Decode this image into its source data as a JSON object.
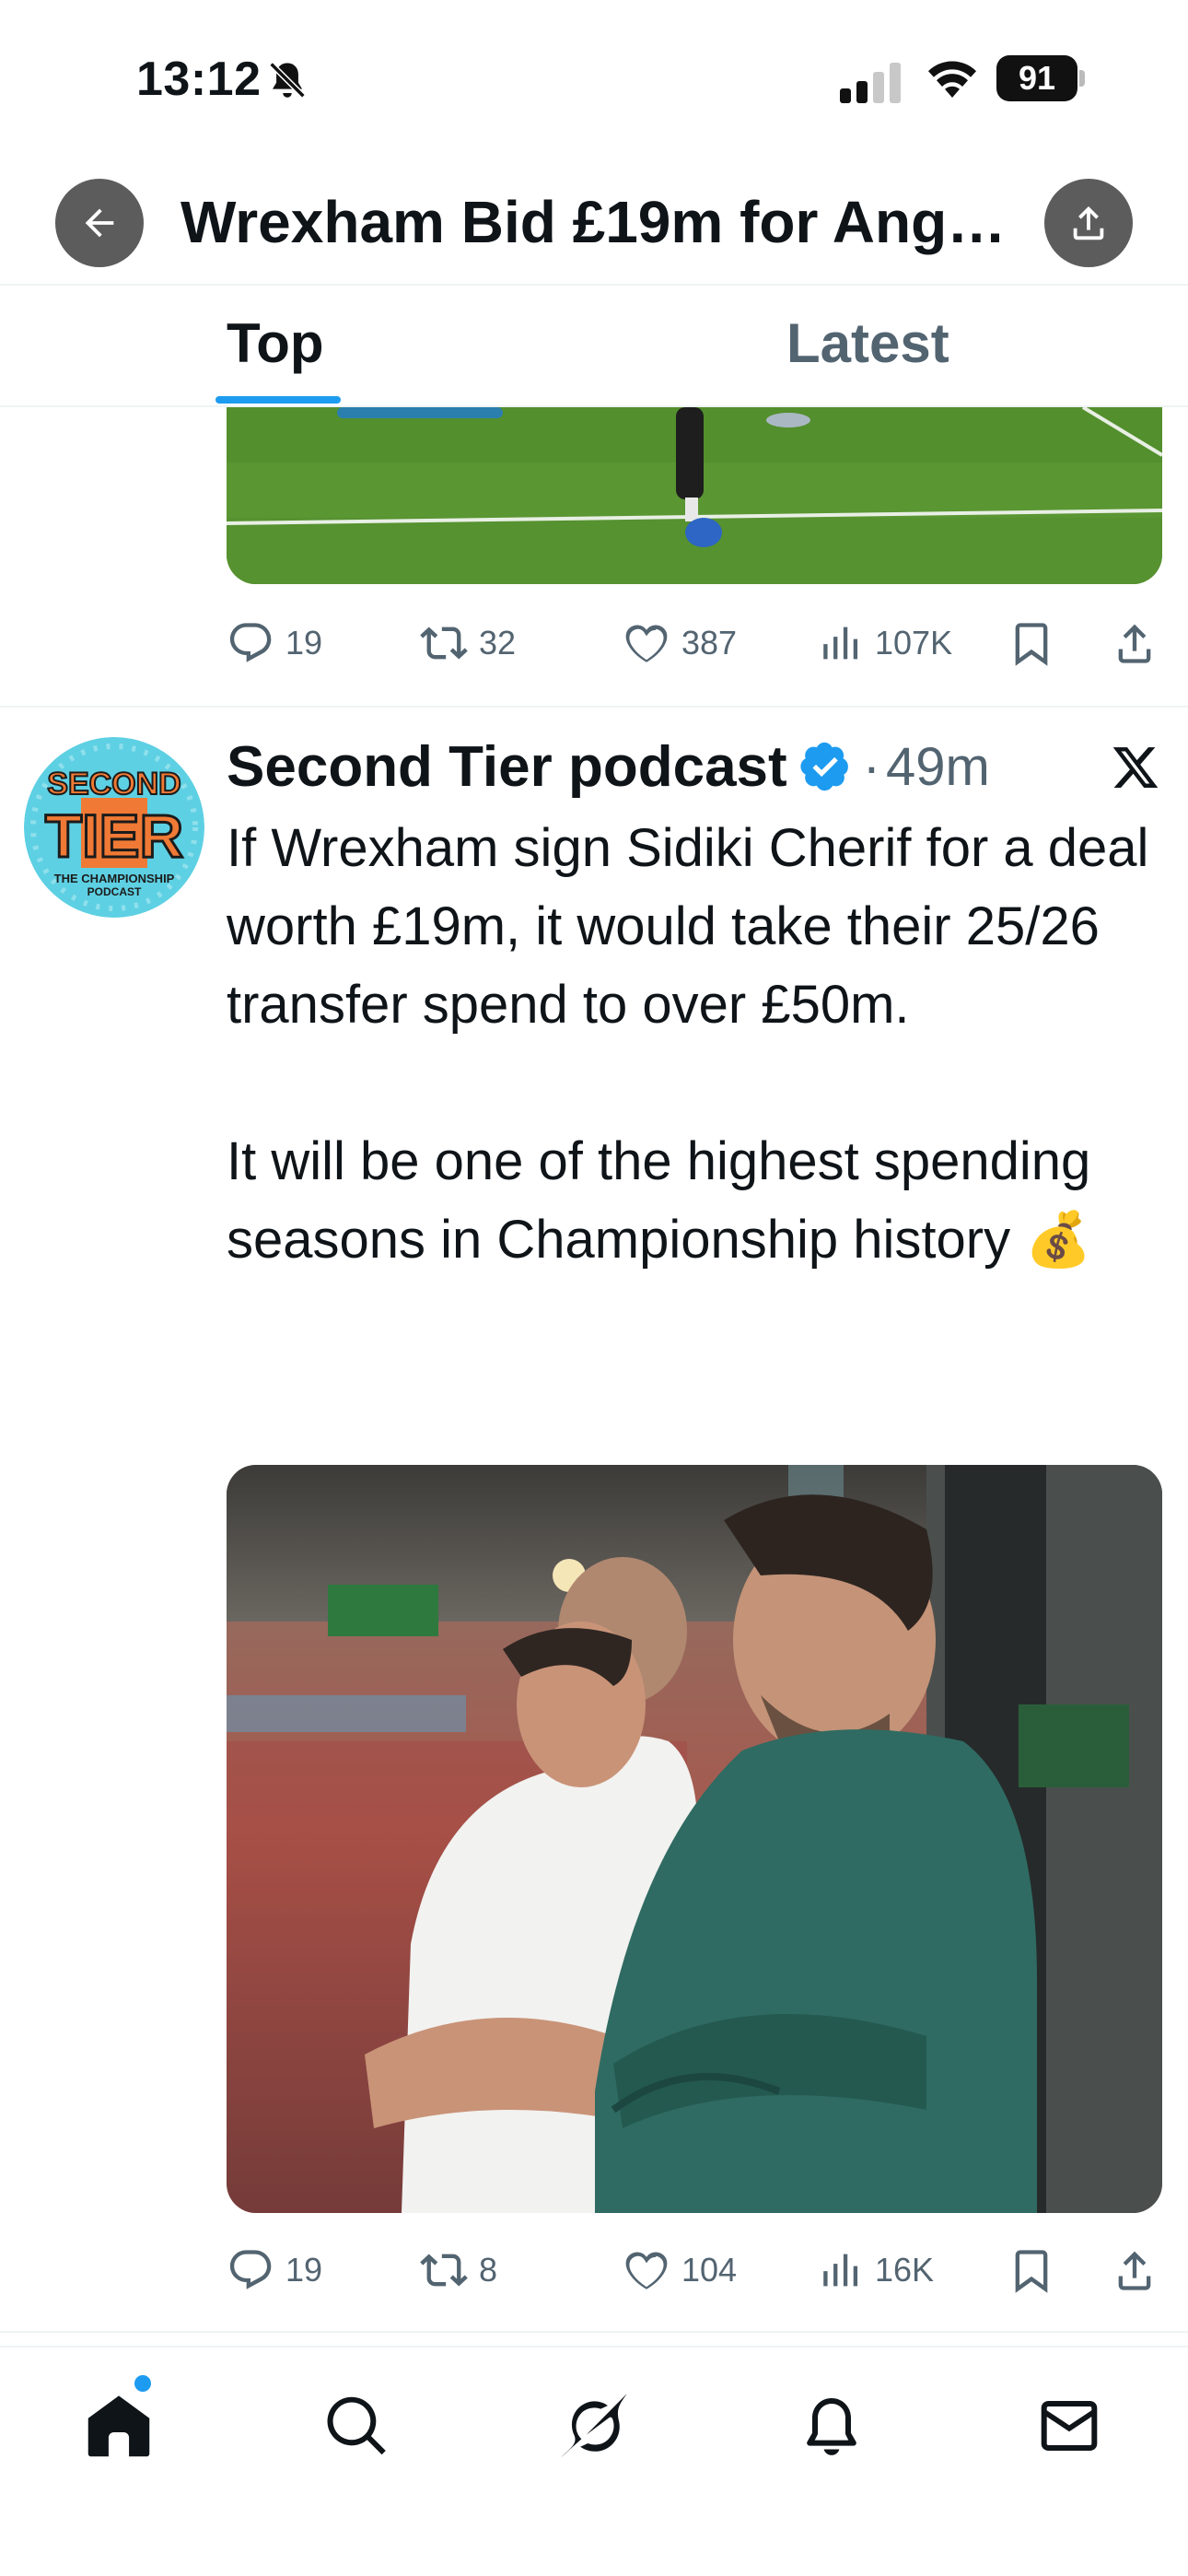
{
  "status_bar": {
    "time": "13:12",
    "battery": "91",
    "icons": [
      "bell-muted-icon",
      "cellular-signal-icon",
      "wifi-icon",
      "battery-icon"
    ]
  },
  "header": {
    "title": "Wrexham Bid £19m for Ange...",
    "back_icon": "arrow-left-icon",
    "share_icon": "share-icon"
  },
  "tabs": [
    {
      "label": "Top",
      "active": true
    },
    {
      "label": "Latest",
      "active": false
    }
  ],
  "prev_tweet": {
    "actions": {
      "replies": "19",
      "reposts": "32",
      "likes": "387",
      "views": "107K"
    }
  },
  "tweet": {
    "author": "Second Tier podcast",
    "verified": true,
    "separator": "·",
    "time": "49m",
    "avatar_text": {
      "line1": "SECOND",
      "line2": "TIER",
      "line3": "THE CHAMPIONSHIP",
      "line4": "PODCAST"
    },
    "paragraph1": "If Wrexham sign Sidiki Cherif for a deal worth £19m, it would take their 25/26 transfer spend to over £50m.",
    "paragraph2": "It will be one of the highest spending seasons in Championship history 💰",
    "actions": {
      "replies": "19",
      "reposts": "8",
      "likes": "104",
      "views": "16K"
    }
  },
  "bottom_nav": {
    "items": [
      "home-icon",
      "search-icon",
      "grok-icon",
      "notifications-icon",
      "messages-icon"
    ]
  },
  "colors": {
    "accent": "#1d9bf0",
    "text": "#0f1419",
    "muted": "#536471",
    "divider": "#eff3f4"
  }
}
